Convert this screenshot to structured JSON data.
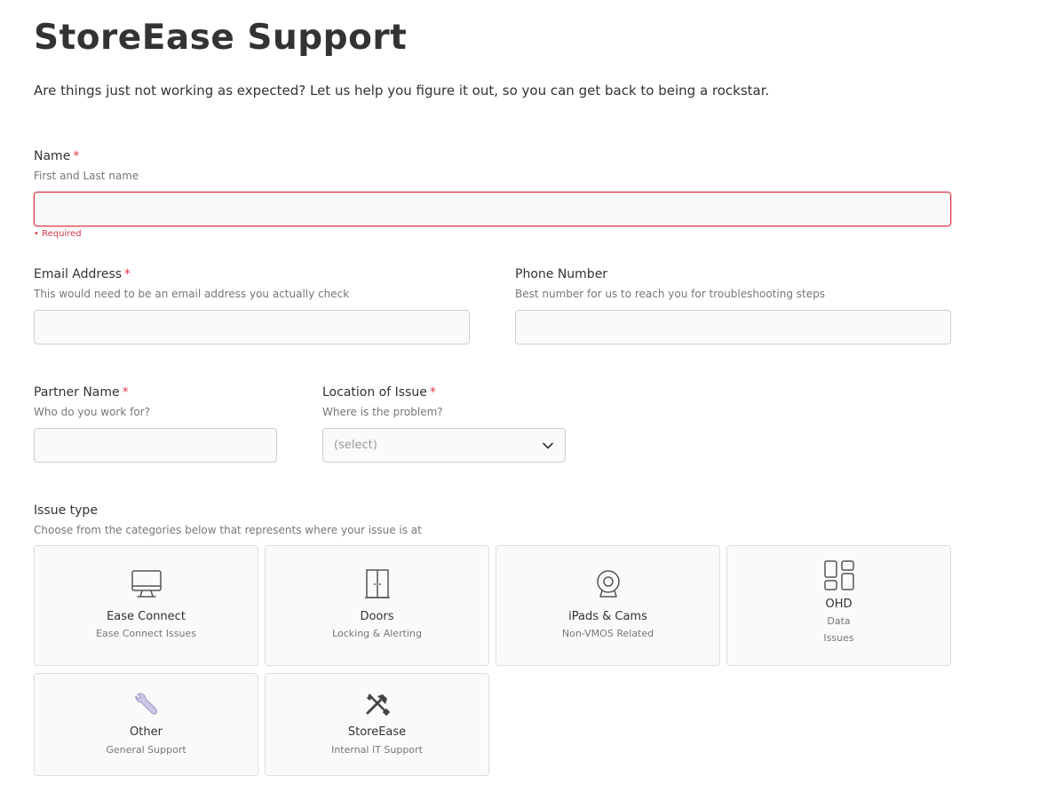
{
  "header": {
    "title": "StoreEase Support",
    "subtitle": "Are things just not working as expected? Let us help you figure it out, so you can get back to being a rockstar."
  },
  "form": {
    "name": {
      "label": "Name",
      "required_mark": "*",
      "hint": "First and Last name",
      "value": "",
      "error": "• Required"
    },
    "email": {
      "label": "Email Address",
      "required_mark": "*",
      "hint": "This would need to be an email address you actually check",
      "value": ""
    },
    "phone": {
      "label": "Phone Number",
      "hint": "Best number for us to reach you for troubleshooting steps",
      "value": ""
    },
    "partner": {
      "label": "Partner Name",
      "required_mark": "*",
      "hint": "Who do you work for?",
      "value": ""
    },
    "location": {
      "label": "Location of Issue",
      "required_mark": "*",
      "hint": "Where is the problem?",
      "selected": "(select)"
    },
    "issue_type": {
      "label": "Issue type",
      "hint": "Choose from the categories below that represents where your issue is at",
      "cards": [
        {
          "title": "Ease Connect",
          "subtitle": "Ease Connect Issues",
          "icon": "monitor-icon"
        },
        {
          "title": "Doors",
          "subtitle": "Locking & Alerting",
          "icon": "door-icon"
        },
        {
          "title": "iPads & Cams",
          "subtitle": "Non-VMOS Related",
          "icon": "webcam-icon"
        },
        {
          "title": "OHD",
          "subtitle_line1": "Data",
          "subtitle_line2": "Issues",
          "icon": "dashboard-icon"
        },
        {
          "title": "Other",
          "subtitle": "General Support",
          "icon": "wrench-icon"
        },
        {
          "title": "StoreEase",
          "subtitle": "Internal IT Support",
          "icon": "tools-icon"
        }
      ]
    }
  },
  "colors": {
    "error": "#e03b4a",
    "text": "#333333",
    "muted": "#777777",
    "border": "#cfcfcf",
    "field_bg": "#fafafa"
  }
}
